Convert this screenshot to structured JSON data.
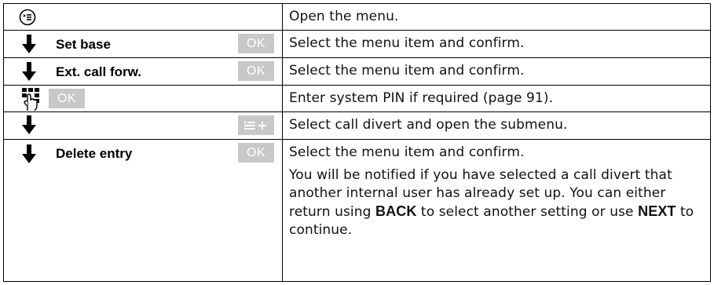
{
  "rows": [
    {
      "icon": "menu-key-icon",
      "label": "",
      "action": "",
      "description": "Open the menu."
    },
    {
      "icon": "down-arrow-icon",
      "label": "Set base",
      "action": "OK",
      "description": "Select the menu item and confirm."
    },
    {
      "icon": "down-arrow-icon",
      "label": "Ext. call forw.",
      "action": "OK",
      "description": "Select the menu item and confirm."
    },
    {
      "icon": "keypad-icon",
      "label": "",
      "action": "OK",
      "description": "Enter system PIN if required (page 91)."
    },
    {
      "icon": "down-arrow-icon",
      "label": "",
      "action": "submenu-icon",
      "description": "Select call divert and open the submenu."
    },
    {
      "icon": "down-arrow-icon",
      "label": "Delete entry",
      "action": "OK",
      "description": "Select the menu item and confirm."
    }
  ],
  "note": {
    "part1": "You will be notified if you have selected a call divert that another internal user has already set up. You can either return using ",
    "key1": "BACK",
    "part2": " to select another setting or use ",
    "key2": "NEXT",
    "part3": " to continue."
  }
}
